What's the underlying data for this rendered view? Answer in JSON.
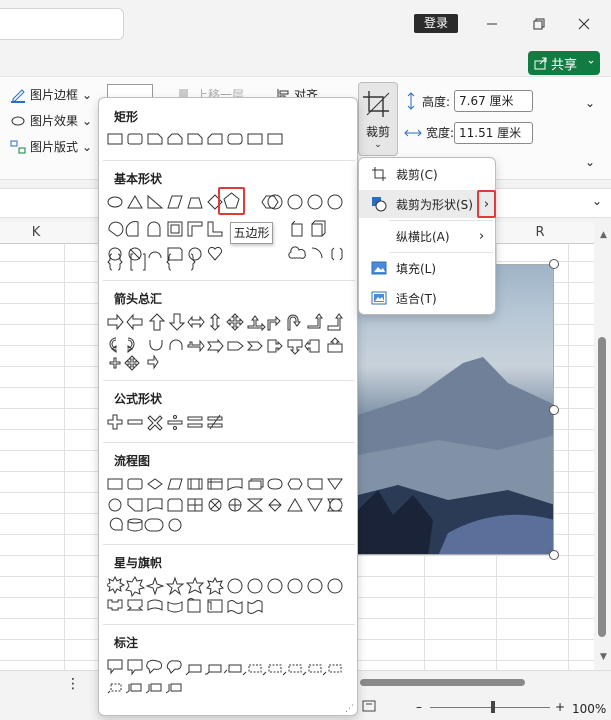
{
  "titlebar": {
    "login_label": "登录"
  },
  "share": {
    "label": "共享"
  },
  "ribbon": {
    "picture_border": "图片边框",
    "picture_effect": "图片效果",
    "picture_layout": "图片版式",
    "bring_forward": "上移一层",
    "align": "对齐",
    "crop": "裁剪",
    "height_label": "高度:",
    "height_value": "7.67 厘米",
    "width_label": "宽度:",
    "width_value": "11.51 厘米"
  },
  "columns": {
    "k": "K",
    "r": "R"
  },
  "shape_gallery": {
    "sections": [
      "矩形",
      "基本形状",
      "箭头总汇",
      "公式形状",
      "流程图",
      "星与旗帜",
      "标注"
    ],
    "tooltip": "五边形",
    "selected_shape": "pentagon-shape"
  },
  "crop_menu": {
    "items": [
      {
        "label": "裁剪(C)",
        "icon": "crop-icon"
      },
      {
        "label": "裁剪为形状(S)",
        "icon": "crop-to-shape-icon",
        "highlighted": true
      },
      {
        "label": "纵横比(A)",
        "icon": ""
      },
      {
        "label": "填充(L)",
        "icon": "fill-image-icon"
      },
      {
        "label": "适合(T)",
        "icon": "fit-image-icon"
      }
    ]
  },
  "status": {
    "zoom": "100%"
  },
  "colors": {
    "accent": "#107c41",
    "highlight": "#e03a3a"
  }
}
